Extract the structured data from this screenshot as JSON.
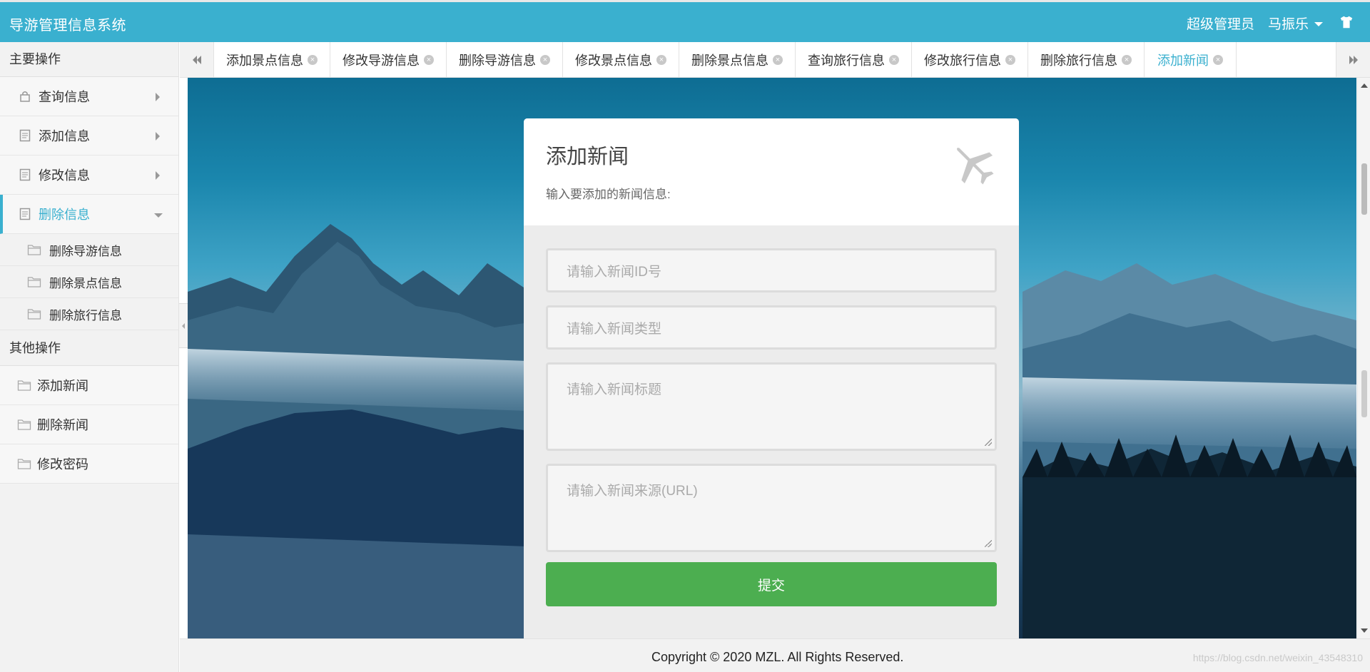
{
  "header": {
    "title": "导游管理信息系统",
    "role": "超级管理员",
    "user": "马振乐",
    "skin_icon": "shirt-icon"
  },
  "sidebar": {
    "main_heading": "主要操作",
    "items": [
      {
        "label": "查询信息",
        "icon": "lock-icon"
      },
      {
        "label": "添加信息",
        "icon": "document-icon"
      },
      {
        "label": "修改信息",
        "icon": "document-icon"
      },
      {
        "label": "删除信息",
        "icon": "document-icon",
        "active": true
      }
    ],
    "sub_items": [
      {
        "label": "删除导游信息",
        "icon": "folder-icon"
      },
      {
        "label": "删除景点信息",
        "icon": "folder-icon"
      },
      {
        "label": "删除旅行信息",
        "icon": "folder-icon"
      }
    ],
    "other_heading": "其他操作",
    "other_items": [
      {
        "label": "添加新闻",
        "icon": "folder-icon"
      },
      {
        "label": "删除新闻",
        "icon": "folder-icon"
      },
      {
        "label": "修改密码",
        "icon": "folder-icon"
      }
    ]
  },
  "tabs": [
    {
      "label": "添加景点信息"
    },
    {
      "label": "修改导游信息"
    },
    {
      "label": "删除导游信息"
    },
    {
      "label": "修改景点信息"
    },
    {
      "label": "删除景点信息"
    },
    {
      "label": "查询旅行信息"
    },
    {
      "label": "修改旅行信息"
    },
    {
      "label": "删除旅行信息"
    },
    {
      "label": "添加新闻",
      "active": true
    }
  ],
  "form": {
    "title": "添加新闻",
    "subtitle": "输入要添加的新闻信息:",
    "id_placeholder": "请输入新闻ID号",
    "type_placeholder": "请输入新闻类型",
    "title_placeholder": "请输入新闻标题",
    "source_placeholder": "请输入新闻来源(URL)",
    "submit_label": "提交"
  },
  "footer": {
    "copyright": "Copyright © 2020 MZL. All Rights Reserved.",
    "watermark": "https://blog.csdn.net/weixin_43548310"
  },
  "colors": {
    "primary": "#3ab0cf",
    "submit": "#4cae50"
  }
}
